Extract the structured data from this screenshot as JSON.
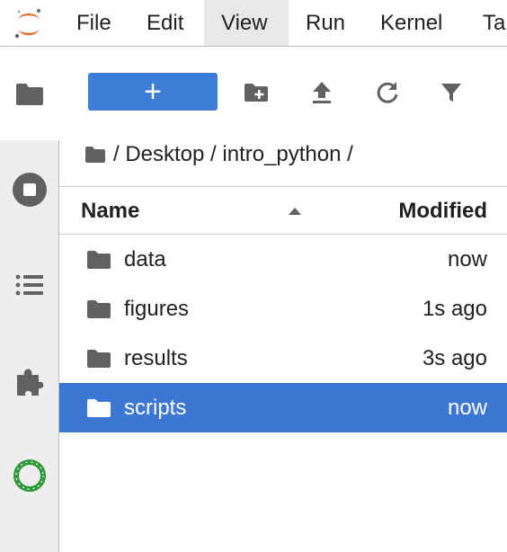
{
  "menubar": {
    "items": [
      "File",
      "Edit",
      "View",
      "Run",
      "Kernel",
      "Ta"
    ],
    "active_index": 2,
    "logo": "jupyter-logo"
  },
  "sidebar": {
    "icons": [
      "folder-icon",
      "stop-circle-icon",
      "list-icon",
      "puzzle-icon",
      "ring-icon"
    ]
  },
  "toolbar": {
    "new_label": "+",
    "icons": [
      "new-folder-icon",
      "upload-icon",
      "refresh-icon",
      "filter-icon"
    ]
  },
  "breadcrumb": {
    "path": "/ Desktop / intro_python /"
  },
  "file_list": {
    "columns": {
      "name": "Name",
      "modified": "Modified"
    },
    "sort": "name-ascending",
    "rows": [
      {
        "name": "data",
        "modified": "now",
        "selected": false
      },
      {
        "name": "figures",
        "modified": "1s ago",
        "selected": false
      },
      {
        "name": "results",
        "modified": "3s ago",
        "selected": false
      },
      {
        "name": "scripts",
        "modified": "now",
        "selected": true
      }
    ]
  },
  "colors": {
    "accent": "#3d7dd8",
    "selection": "#3b77d3",
    "logo_orange": "#e46e2e",
    "extension_green": "#2e9a3a",
    "icon_gray": "#616161"
  }
}
